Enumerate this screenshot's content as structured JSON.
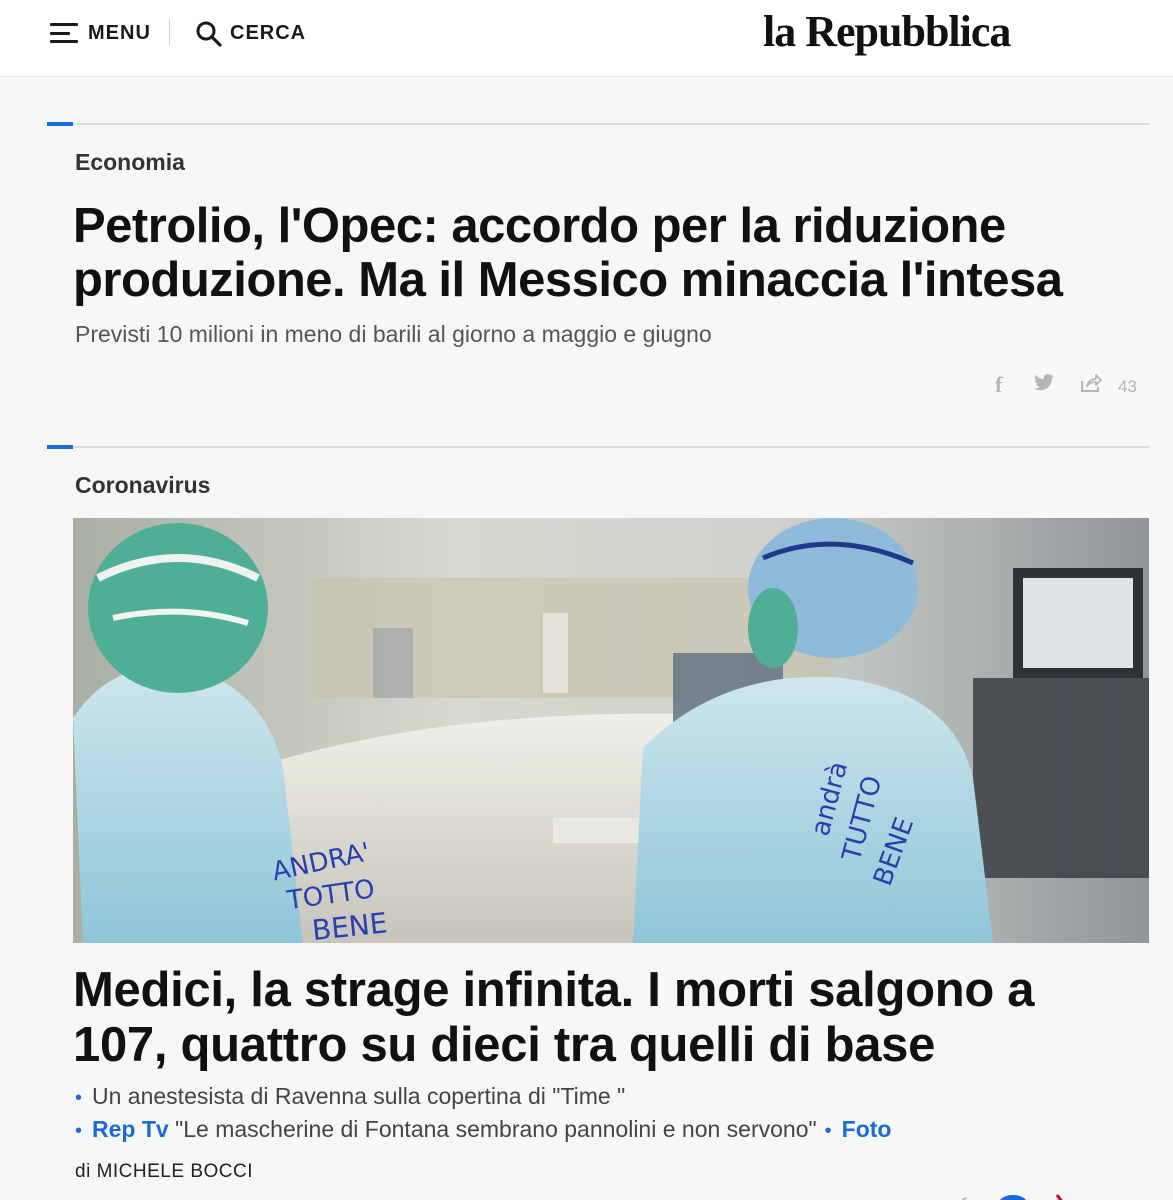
{
  "header": {
    "menu_label": "MENU",
    "search_label": "CERCA",
    "logo_text": "la Repubblica"
  },
  "article1": {
    "section": "Economia",
    "headline": "Petrolio, l'Opec: accordo per la riduzione produzione. Ma il Messico minaccia l'intesa",
    "subhead": "Previsti 10 milioni in meno di barili al giorno a maggio e giugno",
    "share_count": "43"
  },
  "article2": {
    "section": "Coronavirus",
    "headline": "Medici, la strage infinita. I morti salgono a 107, quattro su dieci tra quelli di base",
    "related": [
      {
        "text": "Un anestesista di Ravenna sulla copertina di \"Time \""
      },
      {
        "tag": "Rep Tv",
        "text": " \"Le mascherine di Fontana sembrano pannolini e non servono\"",
        "extra": "Foto"
      }
    ],
    "byline_prefix": "di",
    "author": "MICHELE BOCCI",
    "photo_gown_text_left": "ANDRA' TUTTO BENE",
    "photo_gown_text_right": "andrà TUTTO BENE"
  },
  "colors": {
    "accent": "#1a6ad8",
    "text": "#111111",
    "muted": "#b5b5b5",
    "background": "#f7f7f7"
  },
  "icons": [
    "hamburger-icon",
    "search-icon",
    "facebook-icon",
    "twitter-icon",
    "share-icon"
  ]
}
